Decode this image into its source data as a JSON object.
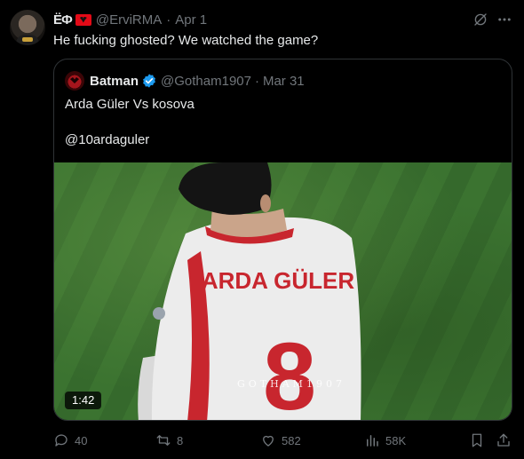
{
  "tweet": {
    "display_name_glyphs": "ЁФ",
    "handle": "@ErviRMA",
    "separator": "·",
    "date": "Apr 1",
    "text": "He fucking ghosted? We watched the game?"
  },
  "quote": {
    "name": "Batman",
    "handle": "@Gotham1907",
    "separator": "·",
    "date": "Mar 31",
    "line1": "Arda Güler Vs kosova",
    "line2": "@10ardaguler",
    "video": {
      "duration": "1:42",
      "watermark": "GOTHAM1907",
      "jersey_name": "ARDA GÜLER",
      "jersey_number": "8"
    }
  },
  "actions": {
    "replies": "40",
    "reposts": "8",
    "likes": "582",
    "views": "58K"
  },
  "colors": {
    "background": "#000000",
    "text": "#e7e9ea",
    "muted": "#71767b",
    "verified": "#1d9bf0",
    "border": "#2f3336"
  },
  "icons": [
    "grok-icon",
    "more-icon",
    "verified-icon",
    "reply-icon",
    "repost-icon",
    "like-icon",
    "views-icon",
    "bookmark-icon",
    "share-icon",
    "turkey-flag-icon"
  ]
}
